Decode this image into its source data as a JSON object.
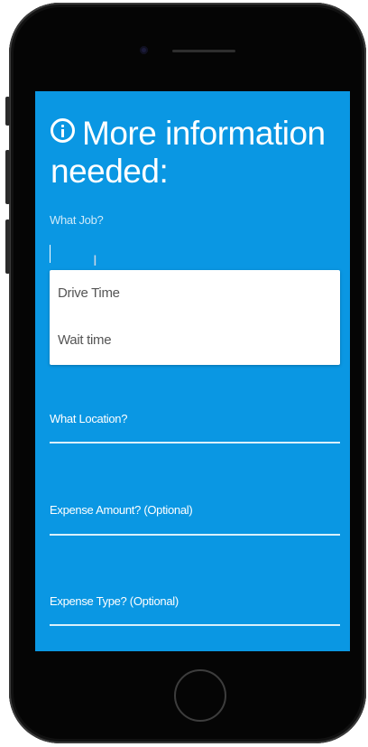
{
  "form": {
    "title": "More information needed:",
    "job": {
      "label": "What Job?",
      "value": "",
      "options": [
        "Drive Time",
        "Wait time"
      ]
    },
    "location": {
      "label": "What Location?",
      "value": ""
    },
    "expense_amount": {
      "label": "Expense Amount? (Optional)",
      "value": ""
    },
    "expense_type": {
      "label": "Expense Type? (Optional)",
      "value": ""
    }
  },
  "colors": {
    "screen_background": "#0a97e3",
    "text": "#ffffff",
    "dropdown_background": "#ffffff",
    "dropdown_text": "#555555"
  },
  "icons": {
    "heading": "info-icon",
    "cursor": "text-cursor-icon"
  }
}
